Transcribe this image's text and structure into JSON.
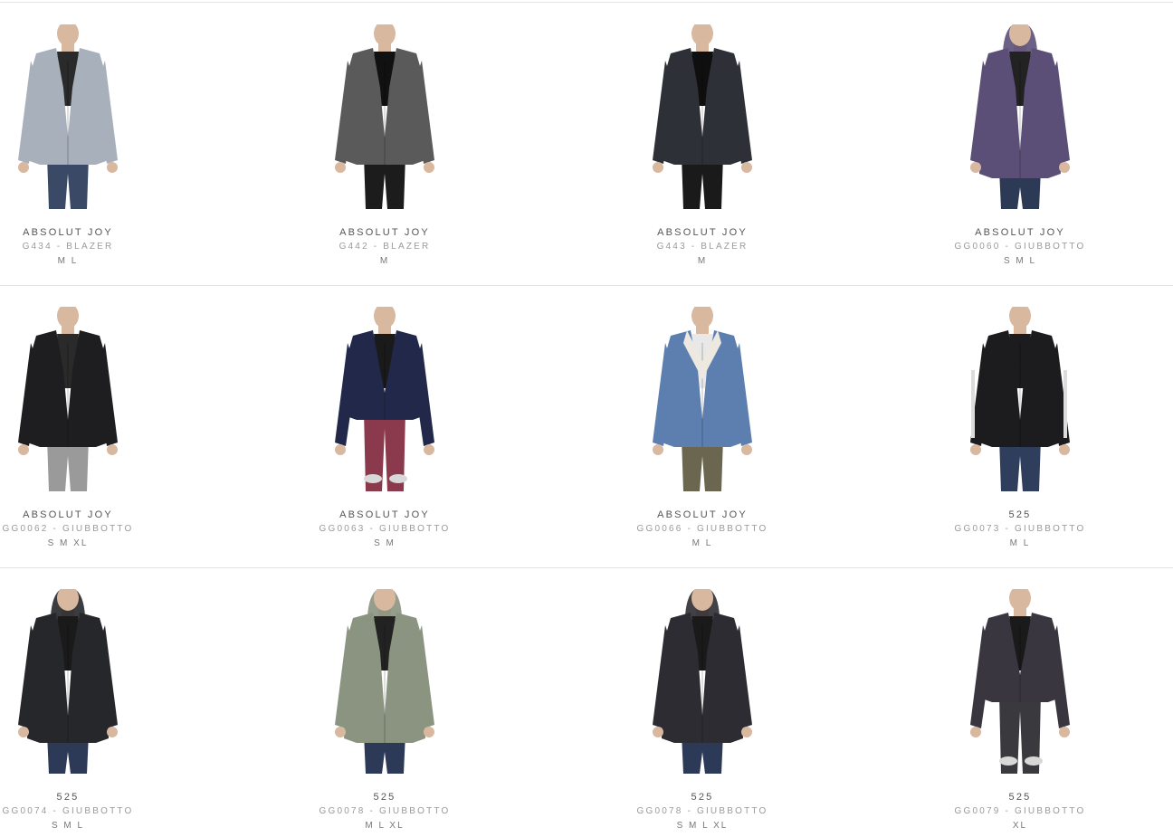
{
  "products": [
    {
      "brand": "ABSOLUT JOY",
      "name": "G434 - BLAZER",
      "sizes": "M L",
      "garment": "blazer",
      "coat_color": "#a8b0bc",
      "pants_color": "#3a4a66",
      "inner_color": "#2a2a2a"
    },
    {
      "brand": "ABSOLUT JOY",
      "name": "G442 - BLAZER",
      "sizes": "M",
      "garment": "blazer",
      "coat_color": "#5a5a5a",
      "pants_color": "#1c1c1c",
      "inner_color": "#111111"
    },
    {
      "brand": "ABSOLUT JOY",
      "name": "G443 - BLAZER",
      "sizes": "M",
      "garment": "blazer",
      "coat_color": "#2e3038",
      "pants_color": "#1a1a1a",
      "inner_color": "#0f0f0f"
    },
    {
      "brand": "ABSOLUT JOY",
      "name": "GG0060 - GIUBBOTTO",
      "sizes": "S M L",
      "garment": "parka",
      "coat_color": "#5b4f78",
      "pants_color": "#2d3a55",
      "inner_color": "#222222"
    },
    {
      "brand": "ABSOLUT JOY",
      "name": "GG0062 - GIUBBOTTO",
      "sizes": "S M XL",
      "garment": "jacket",
      "coat_color": "#1e1e20",
      "pants_color": "#9a9a9a",
      "inner_color": "#2a2a2a"
    },
    {
      "brand": "ABSOLUT JOY",
      "name": "GG0063 - GIUBBOTTO",
      "sizes": "S M",
      "garment": "longcoat",
      "coat_color": "#22284a",
      "pants_color": "#8a3a4c",
      "inner_color": "#1a1a1a"
    },
    {
      "brand": "ABSOLUT JOY",
      "name": "GG0066 - GIUBBOTTO",
      "sizes": "M L",
      "garment": "denim",
      "coat_color": "#5c7fb0",
      "pants_color": "#6a6650",
      "inner_color": "#e8e8e8"
    },
    {
      "brand": "525",
      "name": "GG0073 - GIUBBOTTO",
      "sizes": "M L",
      "garment": "bomber",
      "coat_color": "#1c1c1e",
      "pants_color": "#2f3e5c",
      "inner_color": "#1c1c1e"
    },
    {
      "brand": "525",
      "name": "GG0074 - GIUBBOTTO",
      "sizes": "S M L",
      "garment": "parka",
      "coat_color": "#26272b",
      "pants_color": "#2c3a58",
      "inner_color": "#1a1a1a"
    },
    {
      "brand": "525",
      "name": "GG0078 - GIUBBOTTO",
      "sizes": "M L XL",
      "garment": "parka",
      "coat_color": "#8a9480",
      "pants_color": "#2c3a58",
      "inner_color": "#222222"
    },
    {
      "brand": "525",
      "name": "GG0078 - GIUBBOTTO",
      "sizes": "S M L XL",
      "garment": "parka",
      "coat_color": "#2c2c32",
      "pants_color": "#2c3a58",
      "inner_color": "#1a1a1a"
    },
    {
      "brand": "525",
      "name": "GG0079 - GIUBBOTTO",
      "sizes": "XL",
      "garment": "longcoat",
      "coat_color": "#3a3640",
      "pants_color": "#3a3a3e",
      "inner_color": "#1a1a1a"
    }
  ],
  "colors": {
    "skin": "#d9b8a0",
    "hair": "#6b5a48",
    "divider": "#e4e4e4"
  }
}
